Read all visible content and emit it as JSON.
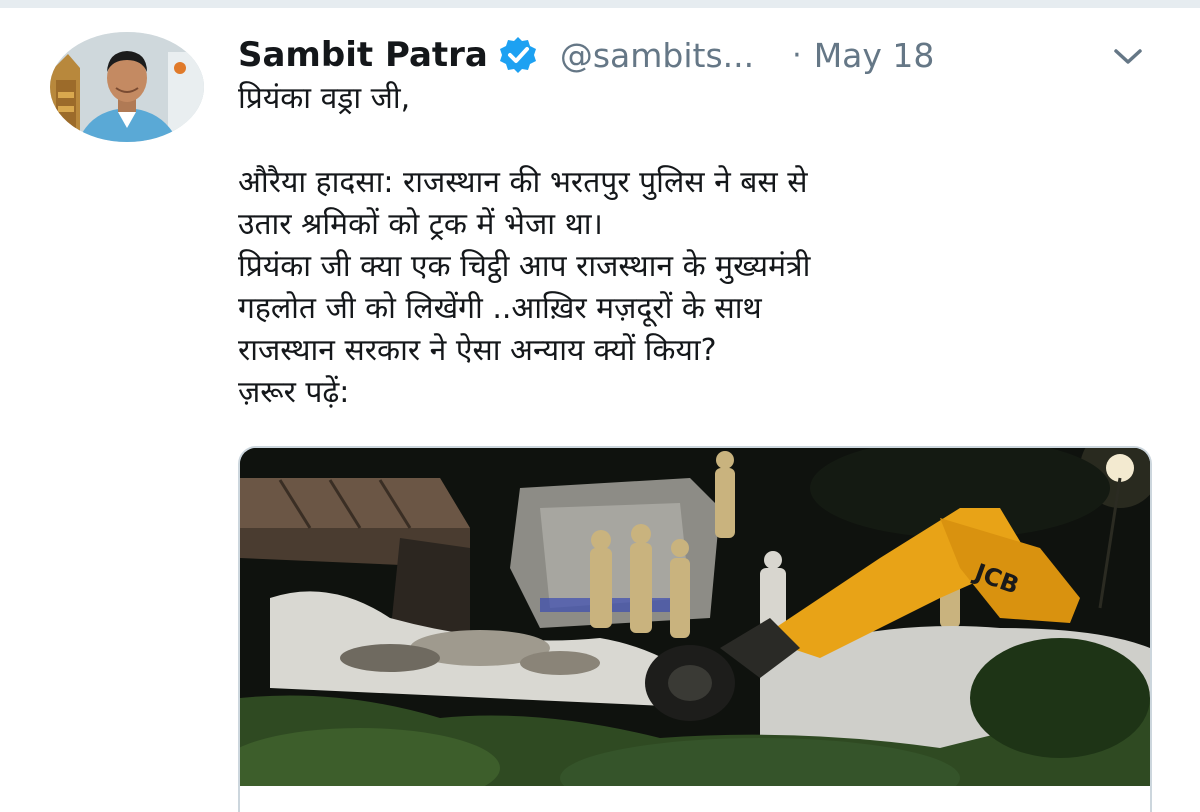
{
  "tweet": {
    "author": {
      "display_name": "Sambit Patra",
      "handle": "@sambits...",
      "verified": true,
      "avatar_icon": "avatar-photo"
    },
    "separator": "·",
    "date": "May 18",
    "menu_icon": "chevron-down-icon",
    "text_lines": [
      "प्रियंका वड्रा जी,",
      "",
      "औरैया हादसा: राजस्थान की भरतपुर पुलिस ने बस से",
      "उतार श्रमिकों को ट्रक में भेजा था।",
      "प्रियंका जी क्या एक चिट्ठी आप राजस्थान के मुख्यमंत्री",
      "गहलोत जी को लिखेंगी ..आख़िर मज़दूरों के साथ",
      "राजस्थान सरकार ने ऐसा अन्याय क्यों किया?",
      "ज़रूर पढ़ें:"
    ],
    "media": {
      "image_icon": "night-accident-scene-photo",
      "machine_brand_text": "JCB"
    }
  },
  "colors": {
    "text_primary": "#14171a",
    "text_secondary": "#657786",
    "verified_blue": "#1da1f2",
    "border": "#ccd6dd",
    "jcb_yellow": "#e8a317"
  }
}
